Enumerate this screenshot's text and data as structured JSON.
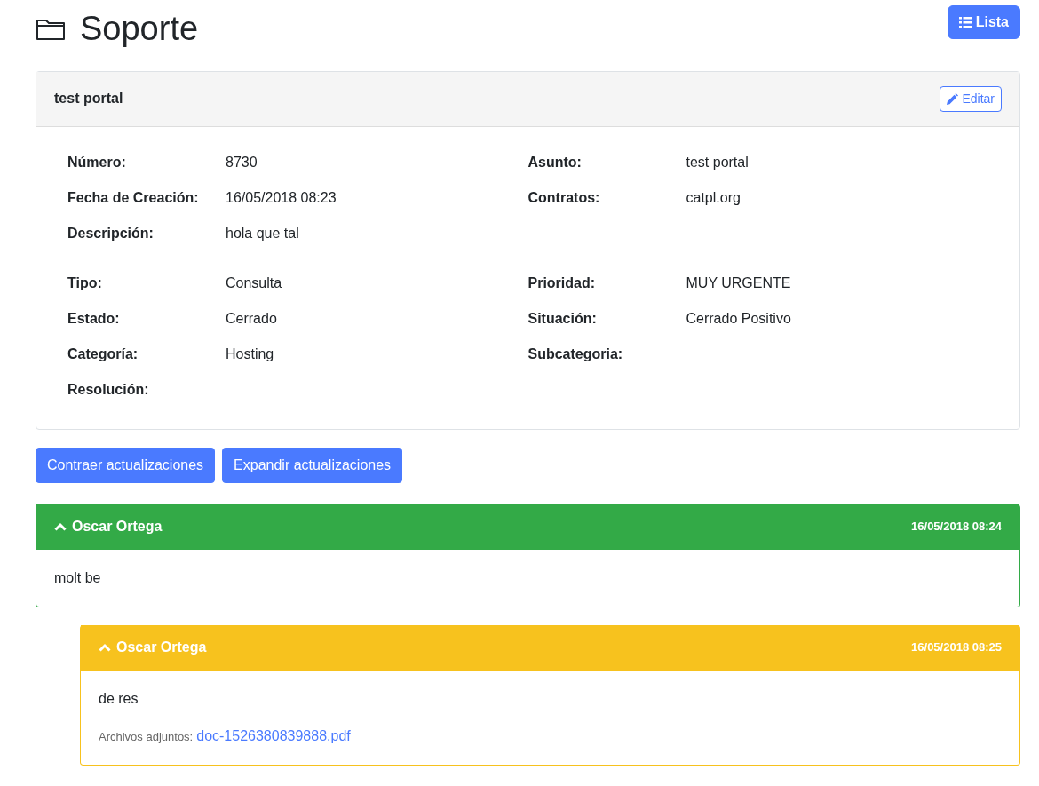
{
  "page": {
    "title": "Soporte",
    "list_button": "Lista"
  },
  "ticket": {
    "title": "test portal",
    "edit_button": "Editar",
    "sections": [
      [
        {
          "left": {
            "label": "Número:",
            "value": "8730"
          },
          "right": {
            "label": "Asunto:",
            "value": "test portal"
          }
        },
        {
          "left": {
            "label": "Fecha de Creación:",
            "value": "16/05/2018 08:23"
          },
          "right": {
            "label": "Contratos:",
            "value": "catpl.org"
          }
        },
        {
          "left": {
            "label": "Descripción:",
            "value": "hola que tal"
          }
        }
      ],
      [
        {
          "left": {
            "label": "Tipo:",
            "value": "Consulta"
          },
          "right": {
            "label": "Prioridad:",
            "value": "MUY URGENTE"
          }
        },
        {
          "left": {
            "label": "Estado:",
            "value": "Cerrado"
          },
          "right": {
            "label": "Situación:",
            "value": "Cerrado Positivo"
          }
        },
        {
          "left": {
            "label": "Categoría:",
            "value": "Hosting"
          },
          "right": {
            "label": "Subcategoria:"
          }
        },
        {
          "left": {
            "label": "Resolución:"
          }
        }
      ]
    ]
  },
  "actions": [
    "Contraer actualizaciones",
    "Expandir actualizaciones"
  ],
  "updates": [
    {
      "author": "Oscar Ortega",
      "date": "16/05/2018 08:24",
      "color": "#33aa47",
      "expanded": true,
      "body": "molt be",
      "children": [
        {
          "author": "Oscar Ortega",
          "date": "16/05/2018 08:25",
          "color": "#f7c21e",
          "expanded": true,
          "body": "de res",
          "attachments_label": "Archivos adjuntos:",
          "attachment": "doc-1526380839888.pdf"
        }
      ]
    }
  ]
}
